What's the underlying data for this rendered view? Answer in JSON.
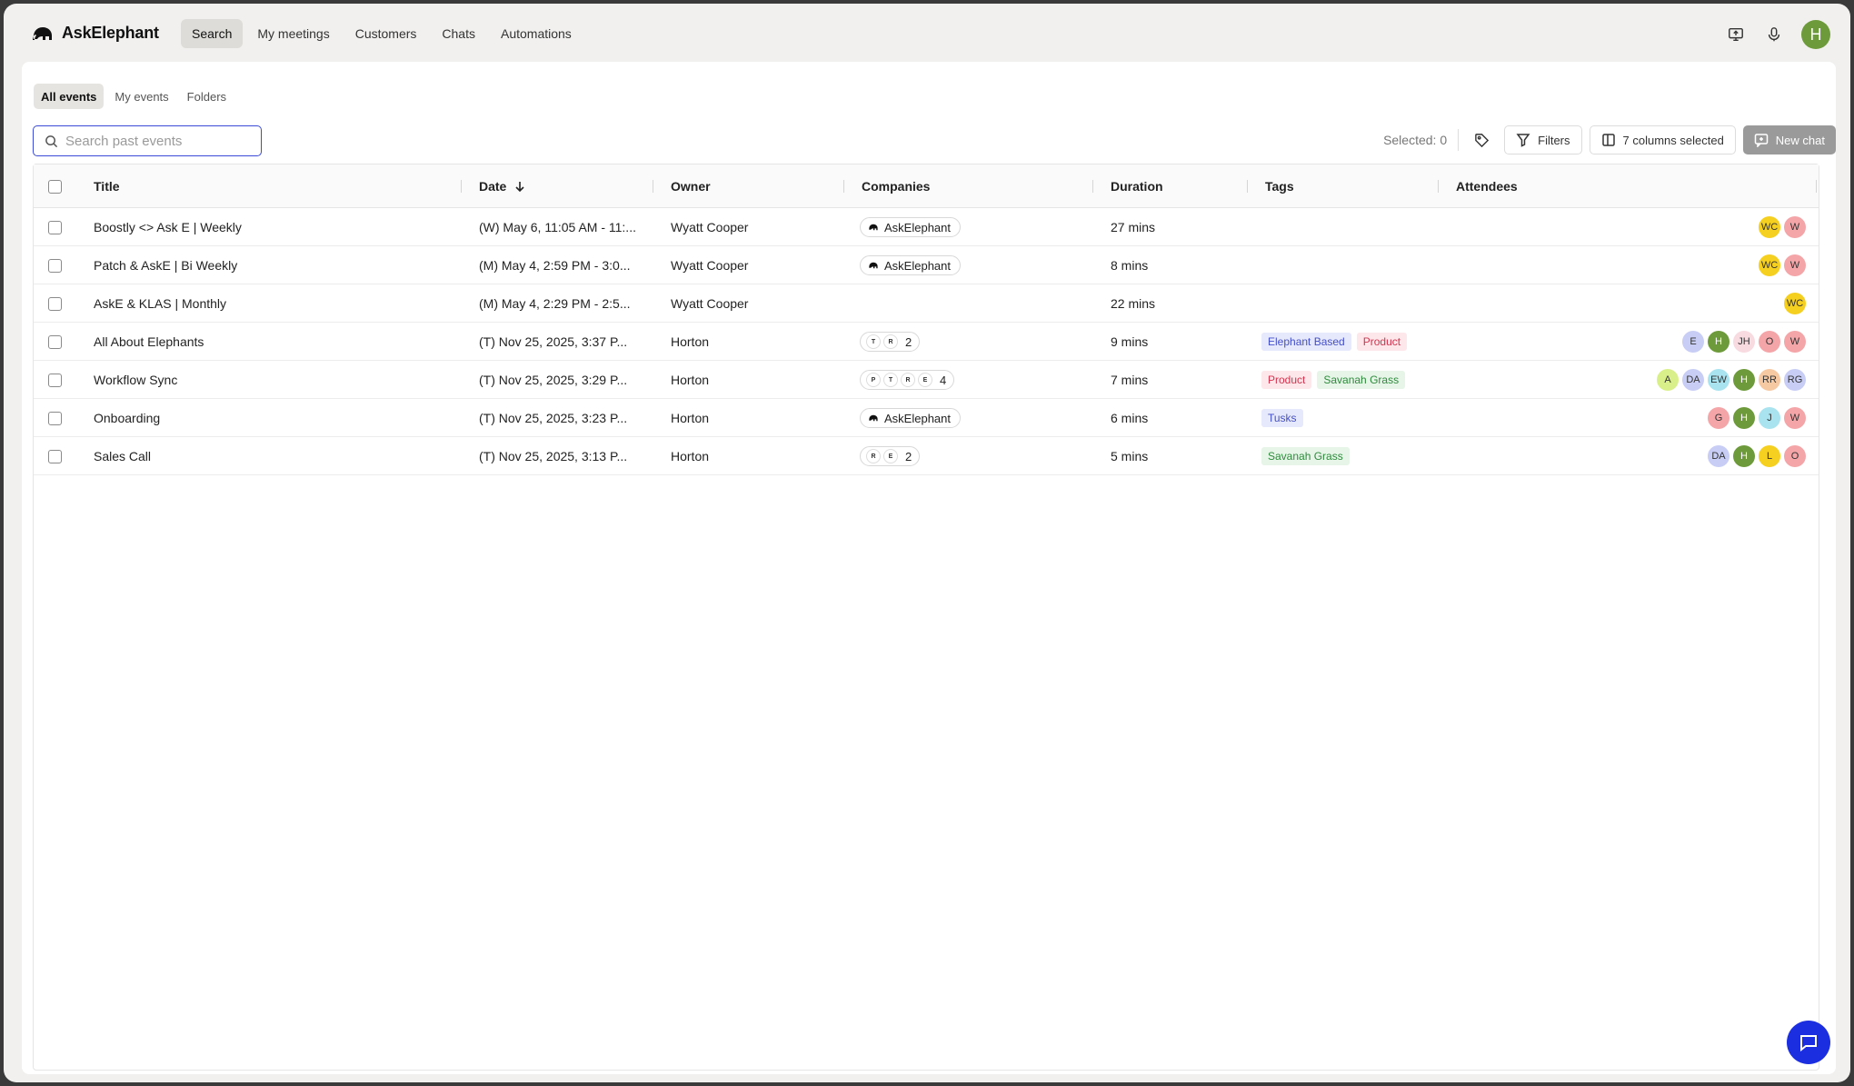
{
  "app": {
    "brand": "AskElephant"
  },
  "nav": {
    "items": [
      {
        "label": "Search",
        "active": true
      },
      {
        "label": "My meetings",
        "active": false
      },
      {
        "label": "Customers",
        "active": false
      },
      {
        "label": "Chats",
        "active": false
      },
      {
        "label": "Automations",
        "active": false
      }
    ]
  },
  "user": {
    "initial": "H",
    "color": "#6d9a3a"
  },
  "subtabs": [
    {
      "label": "All events",
      "active": true
    },
    {
      "label": "My events",
      "active": false
    },
    {
      "label": "Folders",
      "active": false
    }
  ],
  "search": {
    "placeholder": "Search past events",
    "value": ""
  },
  "toolbar": {
    "selected": "Selected: 0",
    "filters": "Filters",
    "columns": "7 columns selected",
    "new_chat": "New chat"
  },
  "columns": {
    "title": "Title",
    "date": "Date",
    "owner": "Owner",
    "companies": "Companies",
    "duration": "Duration",
    "tags": "Tags",
    "attendees": "Attendees"
  },
  "colors": {
    "accent": "#3b4bd8",
    "fab": "#1b2ee0"
  },
  "rows": [
    {
      "title": "Boostly <> Ask E | Weekly",
      "date": "(W) May 6, 11:05 AM - 11:...",
      "owner": "Wyatt Cooper",
      "company": {
        "kind": "pill",
        "name": "AskElephant"
      },
      "duration": "27 mins",
      "tags": [],
      "attendees": [
        {
          "initials": "WC",
          "color": "#f5d020"
        },
        {
          "initials": "W",
          "color": "#f4a5a8"
        }
      ]
    },
    {
      "title": "Patch & AskE | Bi Weekly",
      "date": "(M) May 4, 2:59 PM - 3:0...",
      "owner": "Wyatt Cooper",
      "company": {
        "kind": "pill",
        "name": "AskElephant"
      },
      "duration": "8 mins",
      "tags": [],
      "attendees": [
        {
          "initials": "WC",
          "color": "#f5d020"
        },
        {
          "initials": "W",
          "color": "#f4a5a8"
        }
      ]
    },
    {
      "title": "AskE & KLAS | Monthly",
      "date": "(M) May 4, 2:29 PM - 2:5...",
      "owner": "Wyatt Cooper",
      "company": {
        "kind": "none"
      },
      "duration": "22 mins",
      "tags": [],
      "attendees": [
        {
          "initials": "WC",
          "color": "#f5d020"
        }
      ]
    },
    {
      "title": "All About Elephants",
      "date": "(T) Nov 25, 2025, 3:37 P...",
      "owner": "Horton",
      "company": {
        "kind": "stack",
        "logos": [
          "T",
          "R"
        ],
        "count": "2"
      },
      "duration": "9 mins",
      "tags": [
        {
          "label": "Elephant Based",
          "bg": "#e6e8fb",
          "fg": "#4450c9"
        },
        {
          "label": "Product",
          "bg": "#fde7ea",
          "fg": "#d1354f"
        }
      ],
      "attendees": [
        {
          "initials": "E",
          "color": "#c7cdf5"
        },
        {
          "initials": "H",
          "color": "#6d9a3a"
        },
        {
          "initials": "JH",
          "color": "#f7dbe0"
        },
        {
          "initials": "O",
          "color": "#f4a5a8"
        },
        {
          "initials": "W",
          "color": "#f4a5a8"
        }
      ]
    },
    {
      "title": "Workflow Sync",
      "date": "(T) Nov 25, 2025, 3:29 P...",
      "owner": "Horton",
      "company": {
        "kind": "stack",
        "logos": [
          "P",
          "T",
          "R",
          "E"
        ],
        "count": "4"
      },
      "duration": "7 mins",
      "tags": [
        {
          "label": "Product",
          "bg": "#fde7ea",
          "fg": "#d1354f"
        },
        {
          "label": "Savanah Grass",
          "bg": "#e6f5e8",
          "fg": "#2f8a3c"
        }
      ],
      "attendees": [
        {
          "initials": "A",
          "color": "#d9ef8a"
        },
        {
          "initials": "DA",
          "color": "#c7cdf5"
        },
        {
          "initials": "EW",
          "color": "#a8e3ef"
        },
        {
          "initials": "H",
          "color": "#6d9a3a"
        },
        {
          "initials": "RR",
          "color": "#f6c9a3"
        },
        {
          "initials": "RG",
          "color": "#c7cdf5"
        }
      ]
    },
    {
      "title": "Onboarding",
      "date": "(T) Nov 25, 2025, 3:23 P...",
      "owner": "Horton",
      "company": {
        "kind": "pill",
        "name": "AskElephant"
      },
      "duration": "6 mins",
      "tags": [
        {
          "label": "Tusks",
          "bg": "#e6e8fb",
          "fg": "#4450c9"
        }
      ],
      "attendees": [
        {
          "initials": "G",
          "color": "#f4a5a8"
        },
        {
          "initials": "H",
          "color": "#6d9a3a"
        },
        {
          "initials": "J",
          "color": "#a8e3ef"
        },
        {
          "initials": "W",
          "color": "#f4a5a8"
        }
      ]
    },
    {
      "title": "Sales Call",
      "date": "(T) Nov 25, 2025, 3:13 P...",
      "owner": "Horton",
      "company": {
        "kind": "stack",
        "logos": [
          "R",
          "E"
        ],
        "count": "2"
      },
      "duration": "5 mins",
      "tags": [
        {
          "label": "Savanah Grass",
          "bg": "#e6f5e8",
          "fg": "#2f8a3c"
        }
      ],
      "attendees": [
        {
          "initials": "DA",
          "color": "#c7cdf5"
        },
        {
          "initials": "H",
          "color": "#6d9a3a"
        },
        {
          "initials": "L",
          "color": "#f5d020"
        },
        {
          "initials": "O",
          "color": "#f4a5a8"
        }
      ]
    }
  ]
}
